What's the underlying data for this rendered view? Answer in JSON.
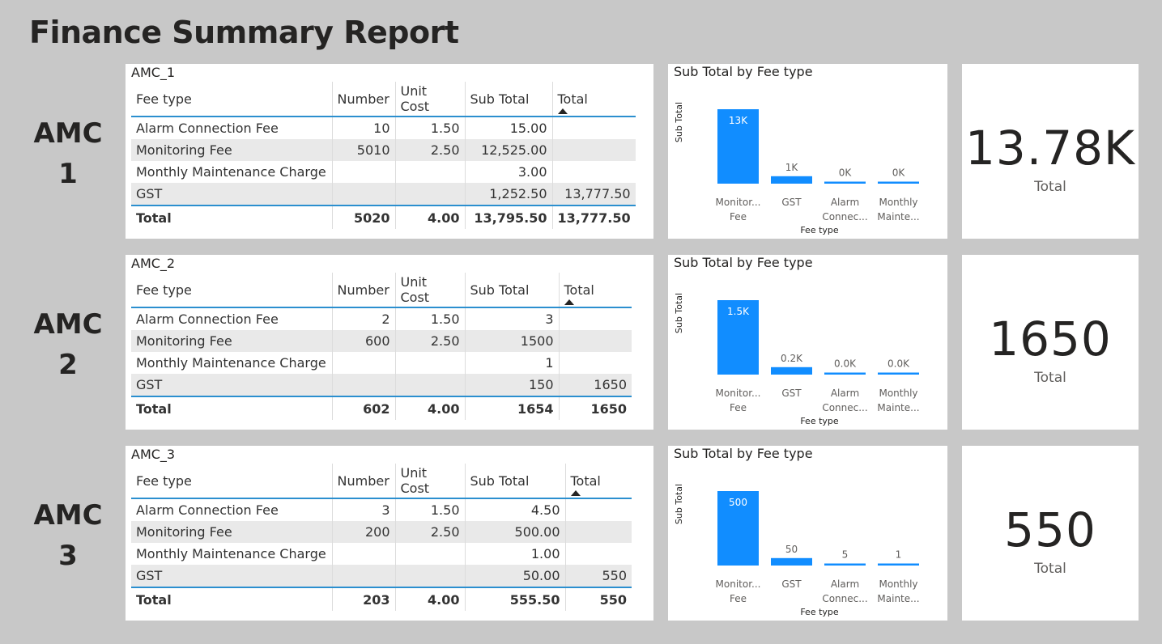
{
  "page": {
    "title": "Finance Summary Report"
  },
  "columns": [
    "Fee type",
    "Number",
    "Unit Cost",
    "Sub Total",
    "Total"
  ],
  "chart_data": [
    {
      "type": "bar",
      "title": "Sub Total by Fee type",
      "xlabel": "Fee type",
      "ylabel": "Sub Total",
      "categories": [
        "Monitoring Fee",
        "GST",
        "Alarm Connection Fee",
        "Monthly Maintenance Charge"
      ],
      "category_labels": [
        [
          "Monitor...",
          "Fee"
        ],
        [
          "GST"
        ],
        [
          "Alarm",
          "Connec..."
        ],
        [
          "Monthly",
          "Mainte..."
        ]
      ],
      "values": [
        12525.0,
        1252.5,
        15.0,
        3.0
      ],
      "data_labels": [
        "13K",
        "1K",
        "0K",
        "0K"
      ],
      "color": "#118DFF"
    },
    {
      "type": "bar",
      "title": "Sub Total by Fee type",
      "xlabel": "Fee type",
      "ylabel": "Sub Total",
      "categories": [
        "Monitoring Fee",
        "GST",
        "Alarm Connection Fee",
        "Monthly Maintenance Charge"
      ],
      "category_labels": [
        [
          "Monitor...",
          "Fee"
        ],
        [
          "GST"
        ],
        [
          "Alarm",
          "Connec..."
        ],
        [
          "Monthly",
          "Mainte..."
        ]
      ],
      "values": [
        1500,
        150,
        3,
        1
      ],
      "data_labels": [
        "1.5K",
        "0.2K",
        "0.0K",
        "0.0K"
      ],
      "color": "#118DFF"
    },
    {
      "type": "bar",
      "title": "Sub Total by Fee type",
      "xlabel": "Fee type",
      "ylabel": "Sub Total",
      "categories": [
        "Monitoring Fee",
        "GST",
        "Alarm Connection Fee",
        "Monthly Maintenance Charge"
      ],
      "category_labels": [
        [
          "Monitor...",
          "Fee"
        ],
        [
          "GST"
        ],
        [
          "Alarm",
          "Connec..."
        ],
        [
          "Monthly",
          "Mainte..."
        ]
      ],
      "values": [
        500.0,
        50.0,
        4.5,
        1.0
      ],
      "data_labels": [
        "500",
        "50",
        "5",
        "1"
      ],
      "color": "#118DFF"
    }
  ],
  "sections": [
    {
      "label_line1": "AMC",
      "label_line2": "1",
      "table_title": "AMC_1",
      "rows": [
        [
          "Alarm Connection Fee",
          "10",
          "1.50",
          "15.00",
          ""
        ],
        [
          "Monitoring Fee",
          "5010",
          "2.50",
          "12,525.00",
          ""
        ],
        [
          "Monthly Maintenance Charge",
          "",
          "",
          "3.00",
          ""
        ],
        [
          "GST",
          "",
          "",
          "1,252.50",
          "13,777.50"
        ]
      ],
      "total_row": [
        "Total",
        "5020",
        "4.00",
        "13,795.50",
        "13,777.50"
      ],
      "card_value": "13.78K",
      "card_caption": "Total"
    },
    {
      "label_line1": "AMC",
      "label_line2": "2",
      "table_title": "AMC_2",
      "rows": [
        [
          "Alarm Connection Fee",
          "2",
          "1.50",
          "3",
          ""
        ],
        [
          "Monitoring Fee",
          "600",
          "2.50",
          "1500",
          ""
        ],
        [
          "Monthly Maintenance Charge",
          "",
          "",
          "1",
          ""
        ],
        [
          "GST",
          "",
          "",
          "150",
          "1650"
        ]
      ],
      "total_row": [
        "Total",
        "602",
        "4.00",
        "1654",
        "1650"
      ],
      "card_value": "1650",
      "card_caption": "Total"
    },
    {
      "label_line1": "AMC",
      "label_line2": "3",
      "table_title": "AMC_3",
      "rows": [
        [
          "Alarm Connection Fee",
          "3",
          "1.50",
          "4.50",
          ""
        ],
        [
          "Monitoring Fee",
          "200",
          "2.50",
          "500.00",
          ""
        ],
        [
          "Monthly Maintenance Charge",
          "",
          "",
          "1.00",
          ""
        ],
        [
          "GST",
          "",
          "",
          "50.00",
          "550"
        ]
      ],
      "total_row": [
        "Total",
        "203",
        "4.00",
        "555.50",
        "550"
      ],
      "card_value": "550",
      "card_caption": "Total"
    }
  ]
}
